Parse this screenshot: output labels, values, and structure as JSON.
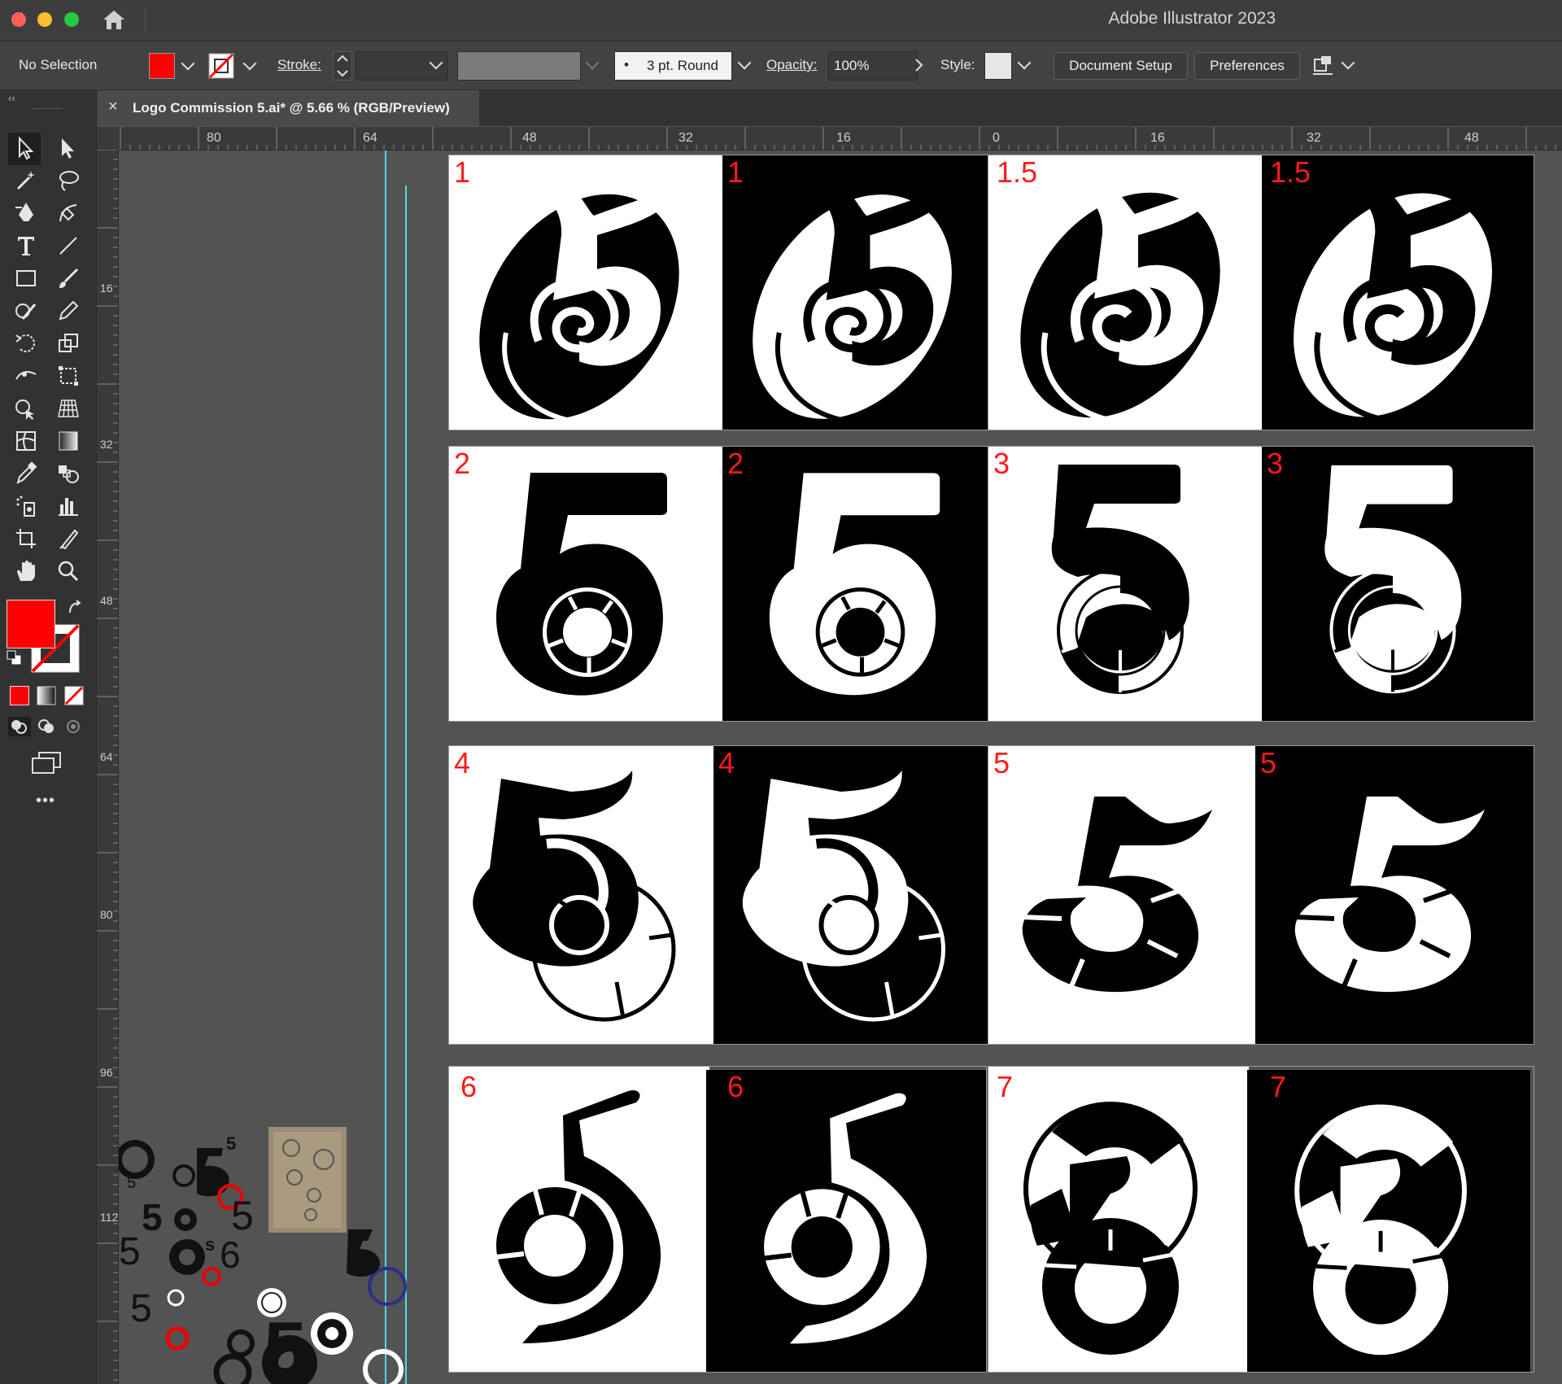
{
  "window": {
    "app_title": "Adobe Illustrator 2023"
  },
  "controlbar": {
    "selection_status": "No Selection",
    "fill_color": "#ff0000",
    "stroke_label": "Stroke:",
    "brush_dot": "•",
    "brush_label": "3 pt. Round",
    "opacity_label": "Opacity:",
    "opacity_value": "100%",
    "style_label": "Style:",
    "document_setup_button": "Document Setup",
    "preferences_button": "Preferences"
  },
  "tab": {
    "close_glyph": "×",
    "title": "Logo Commission 5.ai* @ 5.66 % (RGB/Preview)"
  },
  "ruler": {
    "horizontal": [
      "80",
      "64",
      "48",
      "32",
      "16",
      "0",
      "16",
      "32",
      "48"
    ],
    "vertical": [
      "16",
      "32",
      "48",
      "64",
      "80",
      "96",
      "112"
    ]
  },
  "toolbar": {
    "more_glyph": "•••",
    "collapse_glyph": "‹‹",
    "fill_color": "#ff0000"
  },
  "artboards": {
    "row1": [
      "1",
      "1",
      "1.5",
      "1.5"
    ],
    "row2": [
      "2",
      "2",
      "3",
      "3"
    ],
    "row3": [
      "4",
      "4",
      "5",
      "5"
    ],
    "row4": [
      "6",
      "6",
      "7",
      "7"
    ]
  },
  "scratch": {
    "glyph_small": "5",
    "glyph_medium": "5",
    "glyph_large": "5",
    "glyph_six": "6",
    "glyph_s": "s"
  },
  "colors": {
    "accent_red": "#ff1a1a",
    "guide_cyan": "#4fd7e6",
    "ui_dark": "#323232",
    "canvas_gray": "#535353"
  }
}
